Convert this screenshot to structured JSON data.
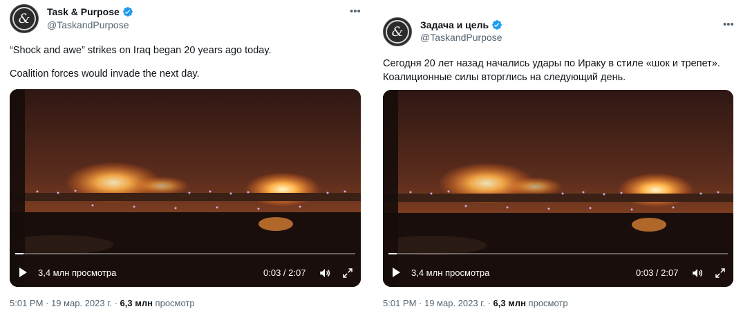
{
  "left": {
    "name": "Task & Purpose",
    "handle": "@TaskandPurpose",
    "text_line1": "“Shock and awe” strikes on Iraq began 20 years ago today.",
    "text_line2": "Coalition forces would invade the next day.",
    "views_label": "3,4 млн просмотра",
    "time_display": "0:03 / 2:07",
    "timestamp": "5:01 PM · 19 мар. 2023 г. · ",
    "view_count": "6,3 млн",
    "view_word": " просмотр",
    "progress": 0.024
  },
  "right": {
    "name": "Задача и цель",
    "handle": "@TaskandPurpose",
    "text_line1": "Сегодня 20 лет назад начались удары по Ираку в стиле «шок и трепет».",
    "text_line2": "Коалиционные силы вторглись на следующий день.",
    "views_label": "3,4 млн просмотра",
    "time_display": "0:03 / 2:07",
    "timestamp": "5:01 PM · 19 мар. 2023 г. · ",
    "view_count": "6,3 млн",
    "view_word": " просмотр",
    "progress": 0.024
  },
  "icons": {
    "avatar": "ampersand-logo",
    "verified": "verified-badge-icon",
    "more": "more-icon",
    "play": "play-icon",
    "volume": "volume-icon",
    "fullscreen": "fullscreen-icon"
  },
  "colors": {
    "verified": "#1d9bf0",
    "handle": "#536471",
    "text": "#0f1419"
  }
}
